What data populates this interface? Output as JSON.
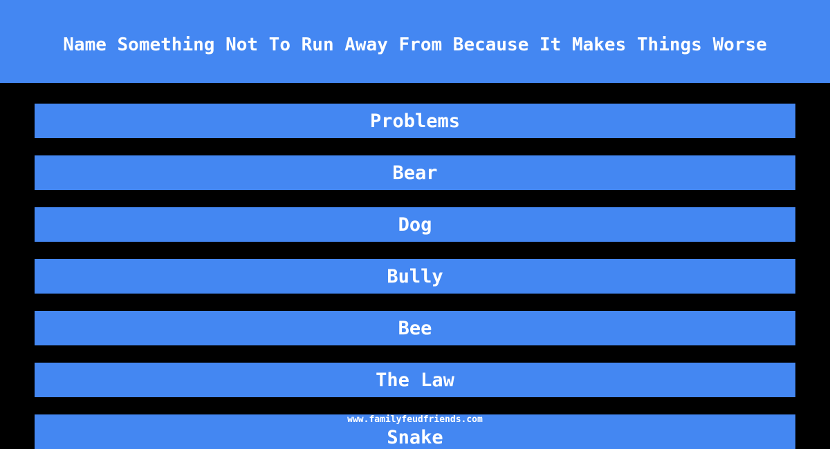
{
  "question": "Name Something Not To Run Away From Because It Makes Things Worse",
  "answers": [
    "Problems",
    "Bear",
    "Dog",
    "Bully",
    "Bee",
    "The Law",
    "Snake"
  ],
  "watermark": "www.familyfeudfriends.com",
  "colors": {
    "accent": "#4487f2",
    "background": "#000000",
    "text": "#ffffff"
  }
}
